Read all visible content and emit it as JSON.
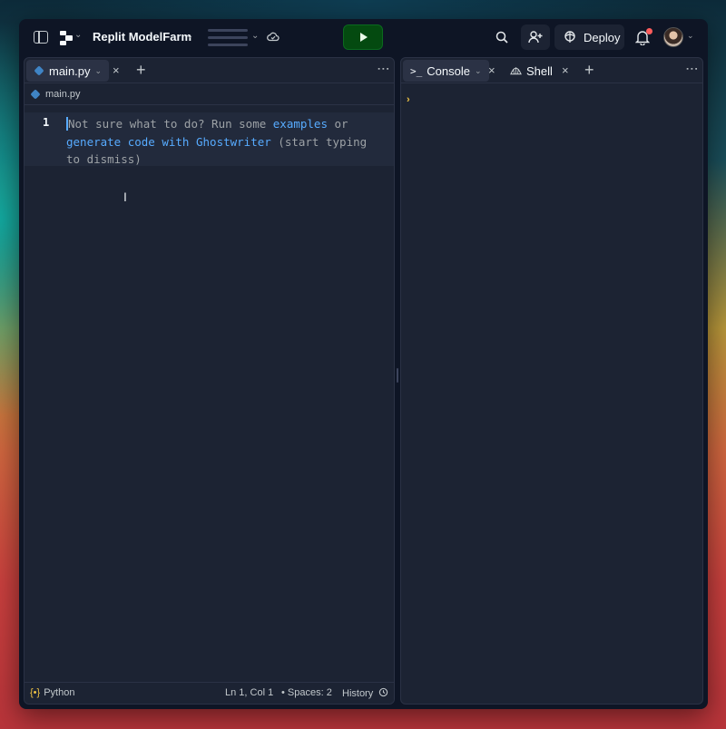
{
  "topbar": {
    "repl_name": "Replit ModelFarm",
    "deploy_label": "Deploy"
  },
  "editor_pane": {
    "tab_label": "main.py",
    "breadcrumb": "main.py",
    "line_number": "1",
    "placeholder": {
      "part1": "Not sure what to do? Run some ",
      "link1": "examples",
      "part2": " or ",
      "link2": "generate code with Ghostwriter",
      "part3": " (start typing to dismiss)"
    },
    "status": {
      "language": "Python",
      "language_icon": "{•}",
      "position": "Ln 1, Col 1",
      "spaces": "• Spaces: 2",
      "history": "History"
    }
  },
  "console_pane": {
    "tabs": [
      {
        "label": "Console",
        "icon": ">_"
      },
      {
        "label": "Shell"
      }
    ],
    "prompt": "›"
  },
  "icons": {
    "close": "×",
    "add": "+",
    "caret": "⌄",
    "more": "⋮",
    "text_cursor": "I"
  }
}
